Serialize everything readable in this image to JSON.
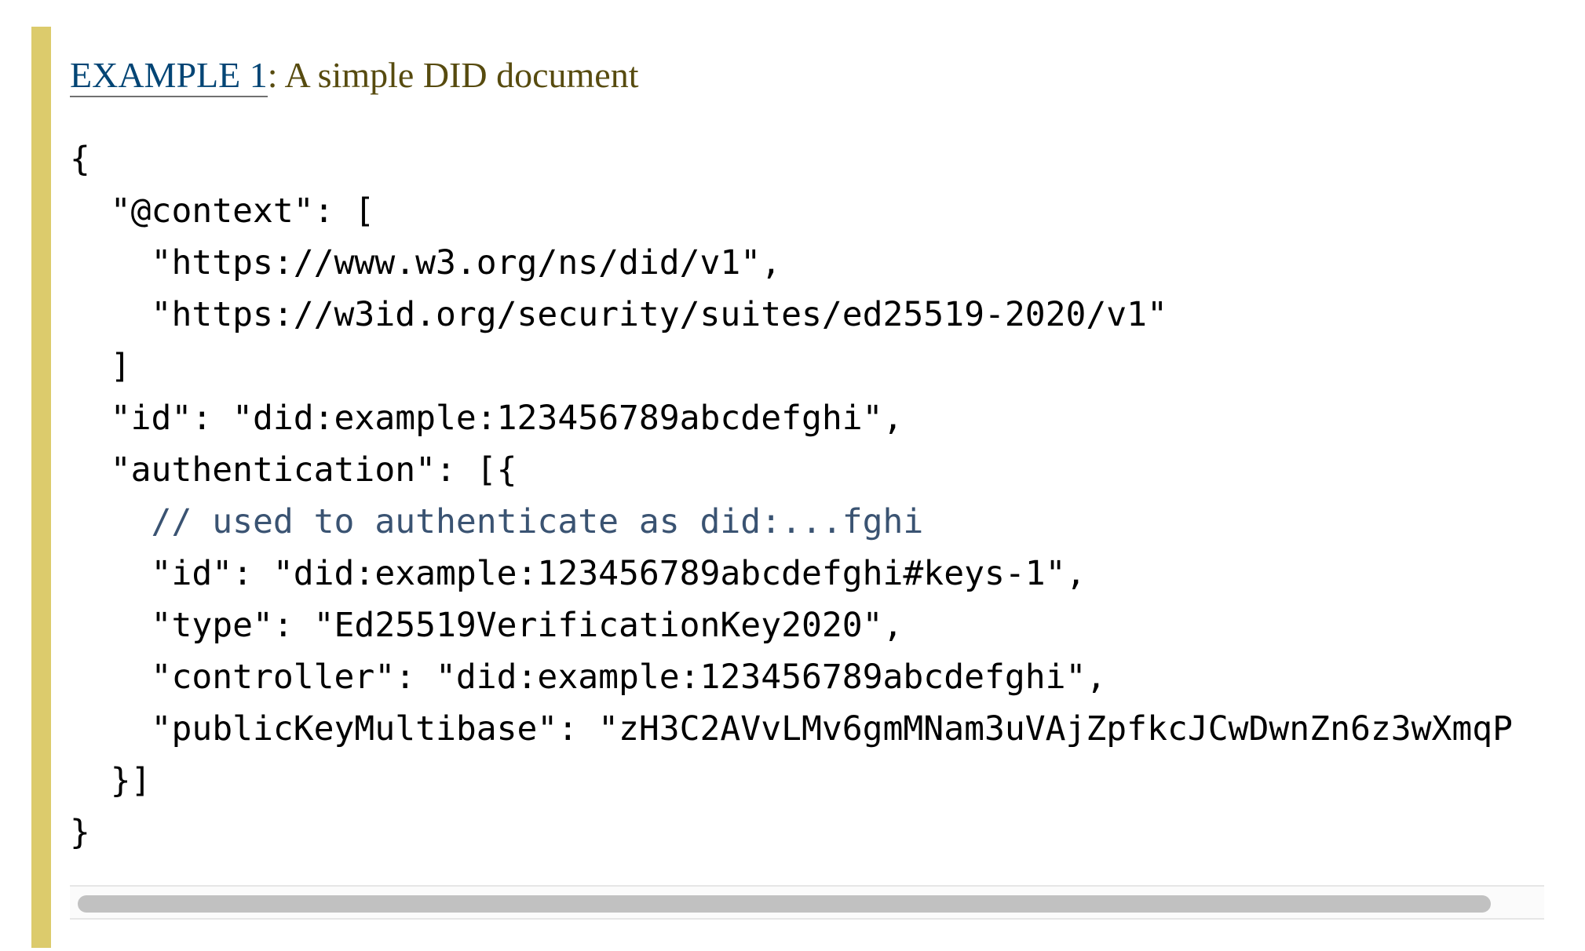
{
  "example": {
    "label": "EXAMPLE 1",
    "separator": ": ",
    "title": "A simple DID document",
    "accent_color": "#dccb6c",
    "link_color": "#034575",
    "title_color": "#574b0f"
  },
  "code": {
    "lines": [
      "{",
      "  \"@context\": [",
      "    \"https://www.w3.org/ns/did/v1\",",
      "    \"https://w3id.org/security/suites/ed25519-2020/v1\"",
      "  ]",
      "  \"id\": \"did:example:123456789abcdefghi\",",
      "  \"authentication\": [{",
      "    // used to authenticate as did:...fghi",
      "    \"id\": \"did:example:123456789abcdefghi#keys-1\",",
      "    \"type\": \"Ed25519VerificationKey2020\",",
      "    \"controller\": \"did:example:123456789abcdefghi\",",
      "    \"publicKeyMultibase\": \"zH3C2AVvLMv6gmMNam3uVAjZpfkcJCwDwnZn6z3wXmqP",
      "  }]",
      "}"
    ],
    "comment_color": "#3a5372"
  },
  "scrollbar": {
    "orientation": "horizontal",
    "thumb_color": "#c1c1c1"
  }
}
